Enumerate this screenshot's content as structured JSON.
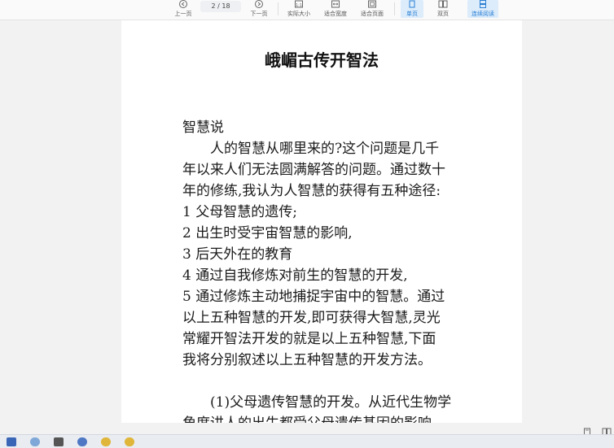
{
  "toolbar": {
    "prev_label": "上一页",
    "page_current": "2",
    "page_total": "/ 18",
    "next_label": "下一页",
    "actual_size_label": "实际大小",
    "fit_width_label": "适合宽度",
    "fit_page_label": "适合页面",
    "single_page_label": "单页",
    "double_page_label": "双页",
    "continuous_label": "连续阅读"
  },
  "document": {
    "title": "峨嵋古传开智法",
    "lines": [
      "智慧说",
      "　　人的智慧从哪里来的?这个问题是几千",
      "年以来人们无法圆满解答的问题。通过数十",
      "年的修练,我认为人智慧的获得有五种途径:",
      "1 父母智慧的遗传;",
      "2 出生时受宇宙智慧的影响,",
      "3 后天外在的教育",
      "4 通过自我修炼对前生的智慧的开发,",
      "5 通过修炼主动地捕捉宇宙中的智慧。通过",
      "以上五种智慧的开发,即可获得大智慧,灵光",
      "常耀开智法开发的就是以上五种智慧,下面",
      "我将分别叙述以上五种智慧的开发方法。",
      "",
      "　　(1)父母遗传智慧的开发。从近代生物学",
      "角度讲人的出生都受父母遗传基因的影响"
    ]
  },
  "colors": {
    "accent": "#2a7fd4",
    "active_bg": "#dcecfb"
  }
}
